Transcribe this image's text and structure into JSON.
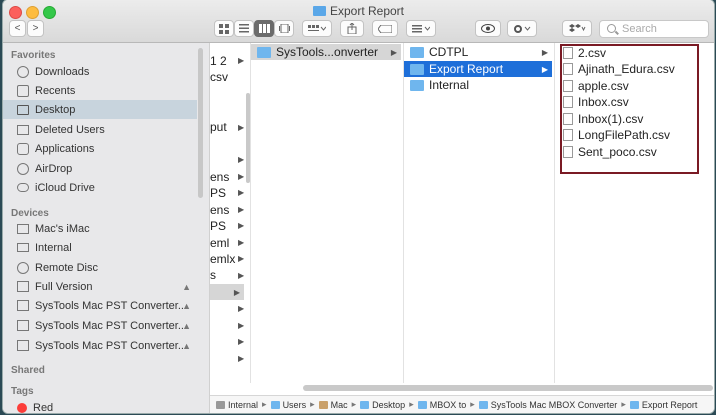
{
  "window": {
    "title": "Export Report"
  },
  "toolbar": {
    "back": "<",
    "forward": ">",
    "search_placeholder": "Search"
  },
  "sidebar": {
    "favorites_label": "Favorites",
    "favorites": [
      {
        "label": "Downloads",
        "icon": "download-icon"
      },
      {
        "label": "Recents",
        "icon": "clock-icon"
      },
      {
        "label": "Desktop",
        "icon": "desktop-icon",
        "selected": true
      },
      {
        "label": "Deleted Users",
        "icon": "folder-icon"
      },
      {
        "label": "Applications",
        "icon": "applications-icon"
      },
      {
        "label": "AirDrop",
        "icon": "airdrop-icon"
      },
      {
        "label": "iCloud Drive",
        "icon": "cloud-icon"
      }
    ],
    "devices_label": "Devices",
    "devices": [
      {
        "label": "Mac's iMac",
        "icon": "imac-icon"
      },
      {
        "label": "Internal",
        "icon": "disk-icon"
      },
      {
        "label": "Remote Disc",
        "icon": "disc-icon"
      },
      {
        "label": "Full Version",
        "icon": "disk-icon",
        "eject": true
      },
      {
        "label": "SysTools Mac PST Converter...",
        "icon": "disk-icon",
        "eject": true
      },
      {
        "label": "SysTools Mac PST Converter...",
        "icon": "disk-icon",
        "eject": true
      },
      {
        "label": "SysTools Mac PST Converter...",
        "icon": "disk-icon",
        "eject": true
      }
    ],
    "shared_label": "Shared",
    "tags_label": "Tags",
    "tags": [
      {
        "label": "Red",
        "color": "#fc3d39"
      }
    ]
  },
  "columns": {
    "col1_fragments": [
      "1 2",
      "csv",
      "put",
      "ens",
      "PS",
      "ens",
      "PS",
      "eml",
      "emlx",
      "s"
    ],
    "col2": [
      {
        "label": "SysTools...onverter"
      }
    ],
    "col3": [
      {
        "label": "CDTPL"
      },
      {
        "label": "Export Report",
        "selected": true
      },
      {
        "label": "Internal"
      }
    ],
    "col4": [
      "2.csv",
      "Ajinath_Edura.csv",
      "apple.csv",
      "Inbox.csv",
      "Inbox(1).csv",
      "LongFilePath.csv",
      "Sent_poco.csv"
    ]
  },
  "pathbar": [
    "Internal",
    "Users",
    "Mac",
    "Desktop",
    "MBOX to",
    "SysTools Mac MBOX Converter",
    "Export Report"
  ],
  "colors": {
    "selection": "#1e6fd9",
    "highlight_border": "#7a1a24",
    "folder": "#6fb6ee"
  }
}
